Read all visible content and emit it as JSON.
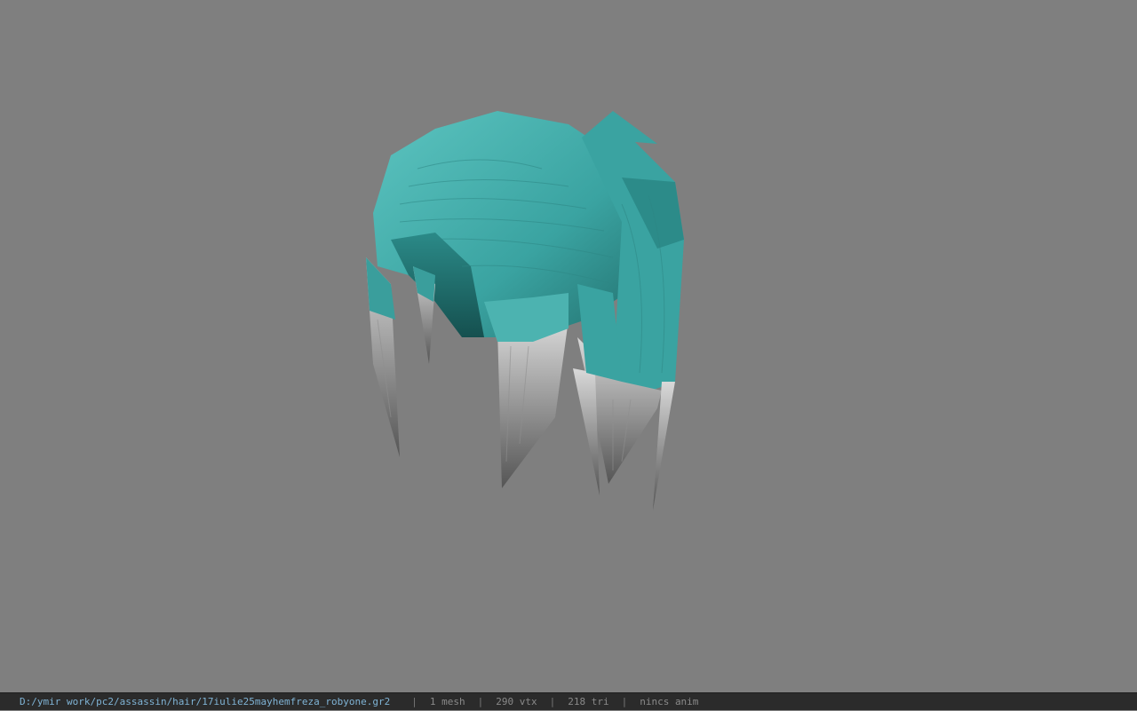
{
  "viewport": {
    "background": "#7f7f7f",
    "model_colors": {
      "hair": "#3aa3a1",
      "hair_light": "#5cc4c0",
      "hair_dark": "#1d6b6a",
      "tips": "#bdbdbd",
      "tips_dark": "#6e6e6e"
    }
  },
  "statusbar": {
    "file_path": "D:/ymir work/pc2/assassin/hair/17iulie25mayhemfreza_robyone.gr2",
    "separator": "|",
    "mesh_count": "1 mesh",
    "vertex_count": "290 vtx",
    "triangle_count": "218 tri",
    "animation": "nincs anim"
  }
}
